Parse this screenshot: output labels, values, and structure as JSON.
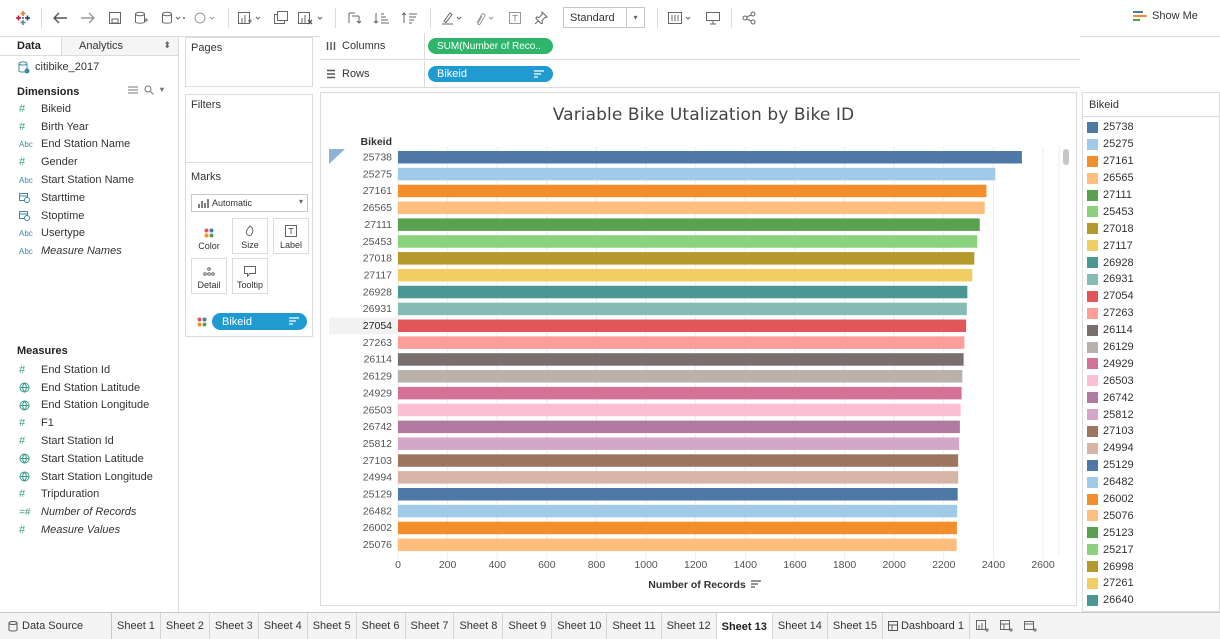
{
  "toolbar": {
    "view_mode": "Standard",
    "show_me_label": "Show Me"
  },
  "data_pane": {
    "tab_data": "Data",
    "tab_analytics": "Analytics",
    "datasource": "citibike_2017",
    "dimensions_header": "Dimensions",
    "dimensions": [
      {
        "type": "#",
        "name": "Bikeid"
      },
      {
        "type": "#",
        "name": "Birth Year"
      },
      {
        "type": "Abc",
        "name": "End Station Name"
      },
      {
        "type": "#",
        "name": "Gender"
      },
      {
        "type": "Abc",
        "name": "Start Station Name"
      },
      {
        "type": "date",
        "name": "Starttime"
      },
      {
        "type": "date",
        "name": "Stoptime"
      },
      {
        "type": "Abc",
        "name": "Usertype"
      },
      {
        "type": "Abc",
        "name": "Measure Names"
      }
    ],
    "measures_header": "Measures",
    "measures": [
      {
        "type": "#",
        "name": "End Station Id"
      },
      {
        "type": "geo",
        "name": "End Station Latitude"
      },
      {
        "type": "geo",
        "name": "End Station Longitude"
      },
      {
        "type": "#",
        "name": "F1"
      },
      {
        "type": "#",
        "name": "Start Station Id"
      },
      {
        "type": "geo",
        "name": "Start Station Latitude"
      },
      {
        "type": "geo",
        "name": "Start Station Longitude"
      },
      {
        "type": "#",
        "name": "Tripduration"
      },
      {
        "type": "=#",
        "name": "Number of Records"
      },
      {
        "type": "#",
        "name": "Measure Values"
      }
    ]
  },
  "cards": {
    "pages": "Pages",
    "filters": "Filters",
    "marks": "Marks",
    "mark_type": "Automatic",
    "buttons": {
      "color": "Color",
      "size": "Size",
      "label": "Label",
      "detail": "Detail",
      "tooltip": "Tooltip"
    },
    "mark_pill": "Bikeid"
  },
  "shelves": {
    "columns_label": "Columns",
    "columns_pill": "SUM(Number of Reco..",
    "rows_label": "Rows",
    "rows_pill": "Bikeid"
  },
  "legend": {
    "title": "Bikeid",
    "items": [
      {
        "label": "25738",
        "color": "#4e79a7"
      },
      {
        "label": "25275",
        "color": "#a0cbe8"
      },
      {
        "label": "27161",
        "color": "#f28e2b"
      },
      {
        "label": "26565",
        "color": "#ffbe7d"
      },
      {
        "label": "27111",
        "color": "#59a14f"
      },
      {
        "label": "25453",
        "color": "#8cd17d"
      },
      {
        "label": "27018",
        "color": "#b6992d"
      },
      {
        "label": "27117",
        "color": "#f1ce63"
      },
      {
        "label": "26928",
        "color": "#499894"
      },
      {
        "label": "26931",
        "color": "#86bcb6"
      },
      {
        "label": "27054",
        "color": "#e15759"
      },
      {
        "label": "27263",
        "color": "#ff9d9a"
      },
      {
        "label": "26114",
        "color": "#79706e"
      },
      {
        "label": "26129",
        "color": "#bab0ac"
      },
      {
        "label": "24929",
        "color": "#d37295"
      },
      {
        "label": "26503",
        "color": "#fabfd2"
      },
      {
        "label": "26742",
        "color": "#b07aa1"
      },
      {
        "label": "25812",
        "color": "#d4a6c8"
      },
      {
        "label": "27103",
        "color": "#9d7660"
      },
      {
        "label": "24994",
        "color": "#d7b5a6"
      },
      {
        "label": "25129",
        "color": "#4e79a7"
      },
      {
        "label": "26482",
        "color": "#a0cbe8"
      },
      {
        "label": "26002",
        "color": "#f28e2b"
      },
      {
        "label": "25076",
        "color": "#ffbe7d"
      },
      {
        "label": "25123",
        "color": "#59a14f"
      },
      {
        "label": "25217",
        "color": "#8cd17d"
      },
      {
        "label": "26998",
        "color": "#b6992d"
      },
      {
        "label": "27261",
        "color": "#f1ce63"
      },
      {
        "label": "26640",
        "color": "#499894"
      }
    ]
  },
  "chart_data": {
    "type": "bar",
    "orientation": "horizontal",
    "title": "Variable Bike Utalization by Bike ID",
    "ylabel": "Bikeid",
    "xlabel": "Number of Records",
    "xlim": [
      0,
      2600
    ],
    "xticks": [
      0,
      200,
      400,
      600,
      800,
      1000,
      1200,
      1400,
      1600,
      1800,
      2000,
      2200,
      2400,
      2600
    ],
    "highlighted_category": "27054",
    "categories": [
      "25738",
      "25275",
      "27161",
      "26565",
      "27111",
      "25453",
      "27018",
      "27117",
      "26928",
      "26931",
      "27054",
      "27263",
      "26114",
      "26129",
      "24929",
      "26503",
      "26742",
      "25812",
      "27103",
      "24994",
      "25129",
      "26482",
      "26002",
      "25076"
    ],
    "values": [
      2515,
      2408,
      2372,
      2365,
      2345,
      2335,
      2323,
      2315,
      2295,
      2293,
      2290,
      2283,
      2280,
      2275,
      2272,
      2268,
      2265,
      2262,
      2258,
      2258,
      2256,
      2254,
      2253,
      2252
    ],
    "colors": [
      "#4e79a7",
      "#a0cbe8",
      "#f28e2b",
      "#ffbe7d",
      "#59a14f",
      "#8cd17d",
      "#b6992d",
      "#f1ce63",
      "#499894",
      "#86bcb6",
      "#e15759",
      "#ff9d9a",
      "#79706e",
      "#bab0ac",
      "#d37295",
      "#fabfd2",
      "#b07aa1",
      "#d4a6c8",
      "#9d7660",
      "#d7b5a6",
      "#4e79a7",
      "#a0cbe8",
      "#f28e2b",
      "#ffbe7d"
    ]
  },
  "sheet_tabs": {
    "data_source": "Data Source",
    "sheets": [
      "Sheet 1",
      "Sheet 2",
      "Sheet 3",
      "Sheet 4",
      "Sheet 5",
      "Sheet 6",
      "Sheet 7",
      "Sheet 8",
      "Sheet 9",
      "Sheet 10",
      "Sheet 11",
      "Sheet 12",
      "Sheet 13",
      "Sheet 14",
      "Sheet 15",
      "Dashboard 1"
    ],
    "active": "Sheet 13"
  }
}
